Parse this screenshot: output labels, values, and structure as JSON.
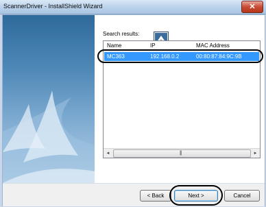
{
  "window": {
    "title": "ScannerDriver - InstallShield Wizard",
    "close_glyph": "✕"
  },
  "content": {
    "search_label": "Search results:",
    "columns": [
      "Name",
      "IP",
      "MAC Address"
    ],
    "rows": [
      {
        "name": "MC363",
        "ip": "192.168.0.2",
        "mac": "00:80:87:84:9C:9B"
      }
    ],
    "selected_row_color": "#3399ff",
    "scroll_grip": "|||"
  },
  "buttons": {
    "back": "< Back",
    "next": "Next >",
    "cancel": "Cancel"
  },
  "icons": {
    "scroll_left": "◄",
    "scroll_right": "►"
  },
  "annotations": {
    "highlight_color": "#000000"
  }
}
